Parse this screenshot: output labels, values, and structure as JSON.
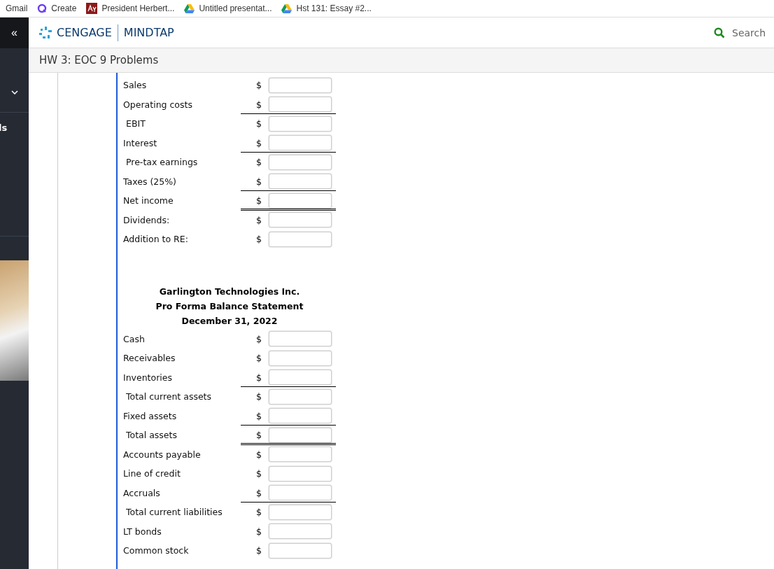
{
  "bookmarks": [
    {
      "label": "Gmail",
      "kind": "text"
    },
    {
      "label": "Create",
      "kind": "q"
    },
    {
      "label": "President Herbert...",
      "kind": "ay"
    },
    {
      "label": "Untitled presentat...",
      "kind": "drive"
    },
    {
      "label": "Hst 131: Essay #2...",
      "kind": "drive"
    }
  ],
  "collapse_button": "«",
  "header": {
    "brand": "CENGAGE",
    "product": "MINDTAP",
    "search_placeholder": "Search"
  },
  "assignment_title": "HW 3: EOC 9 Problems",
  "sidebar": {
    "item_fragment": "ls"
  },
  "income_statement": [
    {
      "label": "Sales",
      "indented": false,
      "underline": false,
      "double_underline": false
    },
    {
      "label": "Operating costs",
      "indented": false,
      "underline": true,
      "double_underline": false
    },
    {
      "label": "EBIT",
      "indented": true,
      "underline": false,
      "double_underline": false
    },
    {
      "label": "Interest",
      "indented": false,
      "underline": true,
      "double_underline": false
    },
    {
      "label": "Pre-tax earnings",
      "indented": true,
      "underline": false,
      "double_underline": false
    },
    {
      "label": "Taxes (25%)",
      "indented": false,
      "underline": true,
      "double_underline": false
    },
    {
      "label": "Net income",
      "indented": false,
      "underline": false,
      "double_underline": true
    },
    {
      "label": "Dividends:",
      "indented": false,
      "underline": false,
      "double_underline": false
    },
    {
      "label": "Addition to RE:",
      "indented": false,
      "underline": false,
      "double_underline": false
    }
  ],
  "balance_sheet": {
    "titles": [
      "Garlington Technologies Inc.",
      "Pro Forma Balance Statement",
      "December 31, 2022"
    ],
    "rows": [
      {
        "label": "Cash",
        "indented": false,
        "underline": false,
        "double_underline": false
      },
      {
        "label": "Receivables",
        "indented": false,
        "underline": false,
        "double_underline": false
      },
      {
        "label": "Inventories",
        "indented": false,
        "underline": true,
        "double_underline": false
      },
      {
        "label": "Total current assets",
        "indented": true,
        "underline": false,
        "double_underline": false
      },
      {
        "label": "Fixed assets",
        "indented": false,
        "underline": true,
        "double_underline": false
      },
      {
        "label": "Total assets",
        "indented": true,
        "underline": false,
        "double_underline": true
      },
      {
        "label": "Accounts payable",
        "indented": false,
        "underline": false,
        "double_underline": false
      },
      {
        "label": "Line of credit",
        "indented": false,
        "underline": false,
        "double_underline": false
      },
      {
        "label": "Accruals",
        "indented": false,
        "underline": true,
        "double_underline": false
      },
      {
        "label": "Total current liabilities",
        "indented": true,
        "underline": false,
        "double_underline": false
      },
      {
        "label": "LT bonds",
        "indented": false,
        "underline": false,
        "double_underline": false
      },
      {
        "label": "Common stock",
        "indented": false,
        "underline": false,
        "double_underline": false
      }
    ]
  },
  "currency_symbol": "$"
}
